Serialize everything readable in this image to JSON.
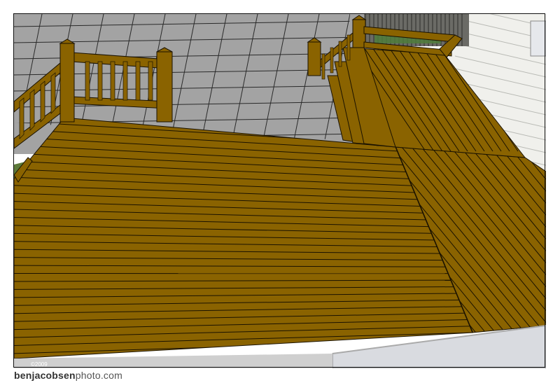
{
  "caption": {
    "site_bold": "benjacobsen",
    "site_rest": "photo.com"
  },
  "watermark": "©2009",
  "colors": {
    "deck": "#8a6300",
    "deck_line": "#1a1200",
    "patio": "#a3a3a3",
    "patio_line": "#2a2a2a",
    "siding": "#f0f0ec",
    "fence": "#4c4c48",
    "frame": "#111111"
  }
}
